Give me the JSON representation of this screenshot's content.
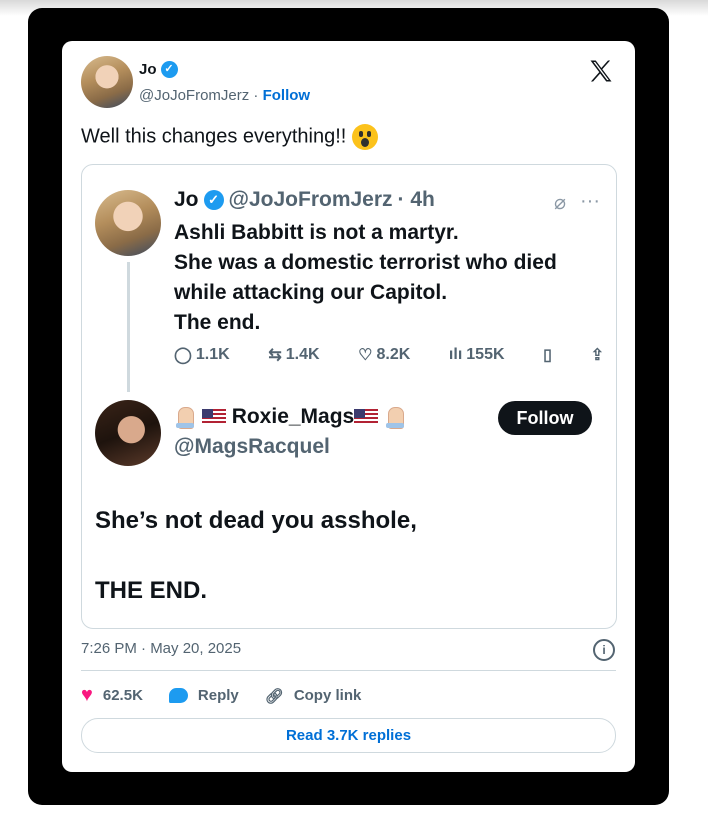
{
  "tweet": {
    "author_name": "Jo",
    "author_handle": "@JoJoFromJerz",
    "separator": "·",
    "follow_label": "Follow",
    "text": "Well this changes everything!!",
    "timestamp": "7:26 PM · May 20, 2025",
    "likes": "62.5K",
    "reply_label": "Reply",
    "copy_link_label": "Copy link",
    "read_replies_label": "Read 3.7K replies"
  },
  "quoted": {
    "author_name": "Jo",
    "author_handle": "@JoJoFromJerz",
    "time": "· 4h",
    "lines": [
      "Ashli Babbitt is not a martyr.",
      "She was a domestic terrorist who died",
      "while attacking our Capitol.",
      "The end."
    ],
    "stats": {
      "replies": "1.1K",
      "reposts": "1.4K",
      "likes": "8.2K",
      "views": "155K"
    }
  },
  "reply": {
    "author_name": "Roxie_Mags",
    "author_handle": "@MagsRacquel",
    "follow_label": "Follow",
    "line1": "She’s not dead you asshole,",
    "line2": "THE END."
  },
  "colors": {
    "brand_blue": "#1d9bf0",
    "like_pink": "#f91880",
    "link_blue": "#006fd6"
  }
}
